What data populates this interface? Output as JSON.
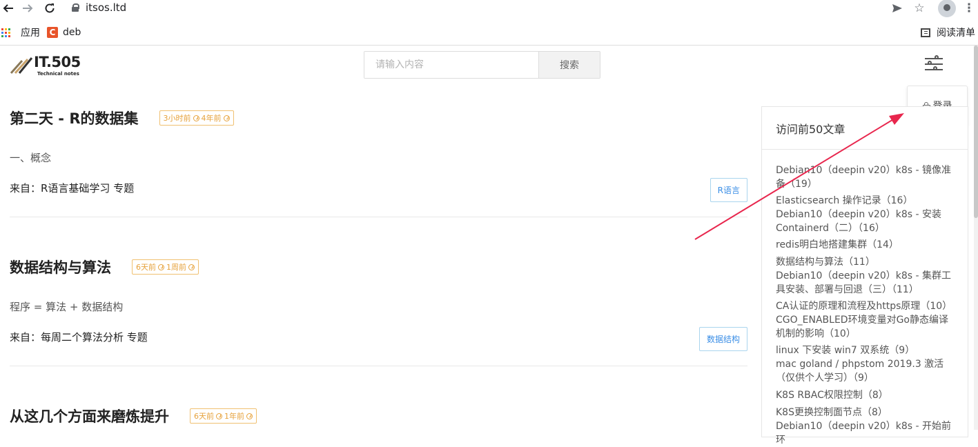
{
  "browser": {
    "url": "itsos.ltd",
    "bookmarks": {
      "apps": "应用",
      "deb": "deb",
      "reading_list": "阅读清单"
    },
    "deb_icon_letter": "C"
  },
  "header": {
    "logo_text": "IT.505",
    "logo_sub": "Technical notes",
    "search_placeholder": "请输入内容",
    "search_button": "搜索",
    "login_label": "登录"
  },
  "articles": [
    {
      "title": "第二天 - R的数据集",
      "badge_a": "3小时前",
      "badge_b": "4年前",
      "excerpt": "一、概念",
      "from": "来自：R语言基础学习 专题",
      "tag": "R语言"
    },
    {
      "title": "数据结构与算法",
      "badge_a": "6天前",
      "badge_b": "1周前",
      "excerpt": "程序 = 算法 + 数据结构",
      "from": "来自：每周二个算法分析 专题",
      "tag": "数据结构"
    },
    {
      "title": "从这几个方面来磨炼提升",
      "badge_a": "6天前",
      "badge_b": "1年前"
    }
  ],
  "sidebar": {
    "title": "访问前50文章",
    "items": [
      "Debian10（deepin v20）k8s - 镜像准备（19）",
      "Elasticsearch 操作记录（16）",
      "Debian10（deepin v20）k8s - 安装Containerd（二）（16）",
      "redis明白地搭建集群（14）",
      "数据结构与算法（11）",
      "Debian10（deepin v20）k8s - 集群工具安装、部署与回退（三）（11）",
      "CA认证的原理和流程及https原理（10）",
      "CGO_ENABLED环境变量对Go静态编译机制的影响（10）",
      "linux 下安装 win7 双系统（9）",
      "mac goland / phpstom 2019.3 激活（仅供个人学习）（9）",
      "K8S RBAC权限控制（8）",
      "K8S更换控制面节点（8）",
      "Debian10（deepin v20）k8s - 开始前环"
    ]
  },
  "colors": {
    "badge": "#e6a23c",
    "tag": "#3a8ee6",
    "arrow": "#e8264d"
  }
}
